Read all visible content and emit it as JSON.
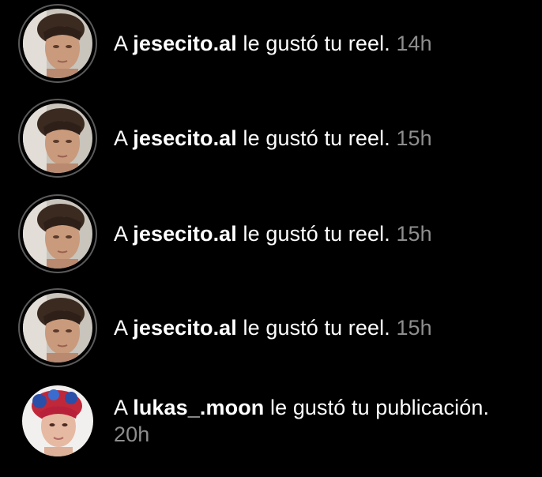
{
  "colors": {
    "background": "#000000",
    "text": "#ffffff",
    "timestamp": "#8e8e8e",
    "story_ring": "#5a5a5a"
  },
  "notifications": [
    {
      "prefix": "A",
      "username": "jesecito.al",
      "action": "le gustó tu reel.",
      "time": "14h",
      "avatar_icon": "profile-photo-jesecito"
    },
    {
      "prefix": "A",
      "username": "jesecito.al",
      "action": "le gustó tu reel.",
      "time": "15h",
      "avatar_icon": "profile-photo-jesecito"
    },
    {
      "prefix": "A",
      "username": "jesecito.al",
      "action": "le gustó tu reel.",
      "time": "15h",
      "avatar_icon": "profile-photo-jesecito"
    },
    {
      "prefix": "A",
      "username": "jesecito.al",
      "action": "le gustó tu reel.",
      "time": "15h",
      "avatar_icon": "profile-photo-jesecito"
    },
    {
      "prefix": "A",
      "username": "lukas_.moon",
      "action": "le gustó tu publicación.",
      "time": "20h",
      "avatar_icon": "profile-photo-lukas"
    }
  ]
}
